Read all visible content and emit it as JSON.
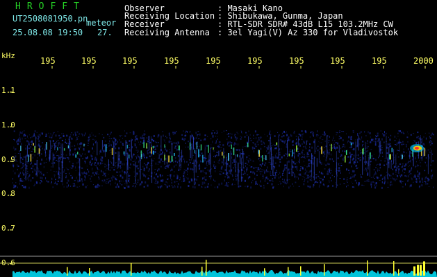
{
  "header": {
    "brand": "HROFFT",
    "file_name": "UT2508081950.pn",
    "meteor_label": "meteor",
    "datetime": "25.08.08 19:50",
    "count": "27.",
    "info": [
      {
        "label": "Observer",
        "value": ": Masaki Kano"
      },
      {
        "label": "Receiving Location",
        "value": ": Shibukawa, Gunma, Japan"
      },
      {
        "label": "Receiver",
        "value": ": RTL-SDR SDR# 43dB L15 103.2MHz CW"
      },
      {
        "label": "Receiving Antenna",
        "value": ": 3el Yagi(V) Az 330 for Vladivostok"
      }
    ]
  },
  "axis": {
    "y_unit": "kHz",
    "y_ticks": [
      "1.1",
      "1.0",
      "0.9",
      "0.8",
      "0.7",
      "0.6"
    ],
    "x_ticks": [
      "195",
      "195",
      "195",
      "195",
      "195",
      "195",
      "195",
      "195",
      "195",
      "2000"
    ]
  },
  "colors": {
    "background": "#000000",
    "header_text": "#ffffff",
    "brand_green": "#26d326",
    "filename_cyan": "#7fe9e9",
    "tick_yellow": "#ffff66",
    "noise_blue": "#1a2a9a",
    "spectrum_cyan": "#00e5ff"
  }
}
